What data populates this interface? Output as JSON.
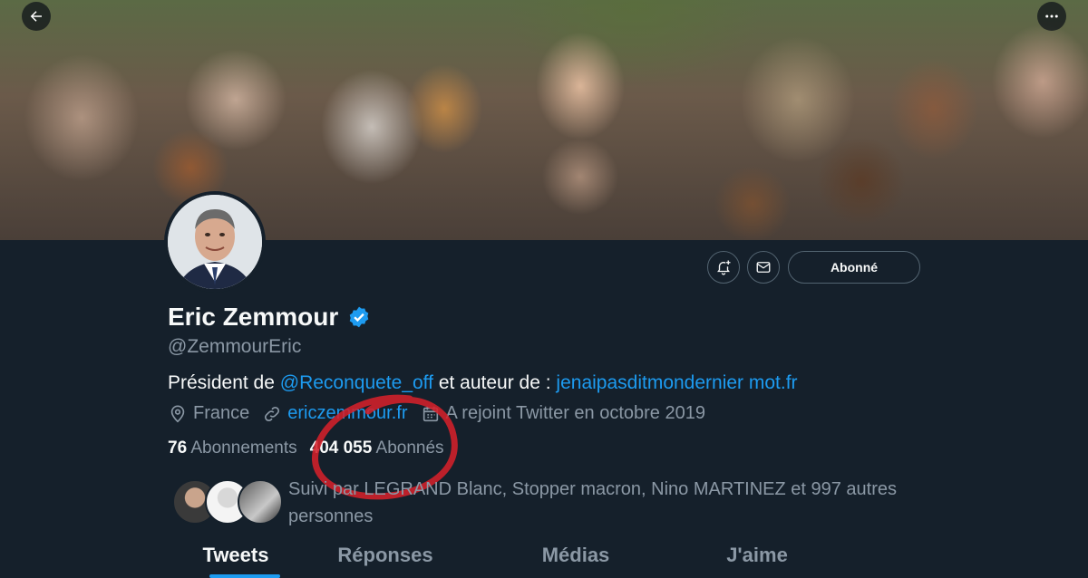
{
  "profile": {
    "name": "Eric Zemmour",
    "handle": "@ZemmourEric",
    "verified": true,
    "bio_prefix": "Président de ",
    "bio_mention": "@Reconquete_off",
    "bio_middle": " et auteur de : ",
    "bio_link": "jenaipasditmondernier mot.fr",
    "location": "France",
    "website": "ericzemmour.fr",
    "joined": "A rejoint Twitter en octobre 2019"
  },
  "stats": {
    "following_count": "76",
    "following_label": "Abonnements",
    "followers_count": "404 055",
    "followers_label": "Abonnés"
  },
  "follow_button": {
    "label": "Abonné"
  },
  "followed_by": {
    "text": "Suivi par LEGRAND Blanc, Stopper macron, Nino MARTINEZ et 997 autres personnes"
  },
  "tabs": [
    {
      "label": "Tweets",
      "active": true
    },
    {
      "label": "Réponses",
      "active": false
    },
    {
      "label": "Médias",
      "active": false
    },
    {
      "label": "J'aime",
      "active": false
    }
  ],
  "icons": {
    "back": "arrow-left-icon",
    "more": "ellipsis-icon",
    "notify": "bell-plus-icon",
    "message": "envelope-icon",
    "verified": "verified-badge-icon",
    "location": "location-pin-icon",
    "website": "link-icon",
    "joined": "calendar-icon"
  },
  "colors": {
    "background": "#15202b",
    "accent": "#1d9bf0",
    "muted_text": "#8b98a5",
    "annotation_circle": "#d4202a"
  }
}
